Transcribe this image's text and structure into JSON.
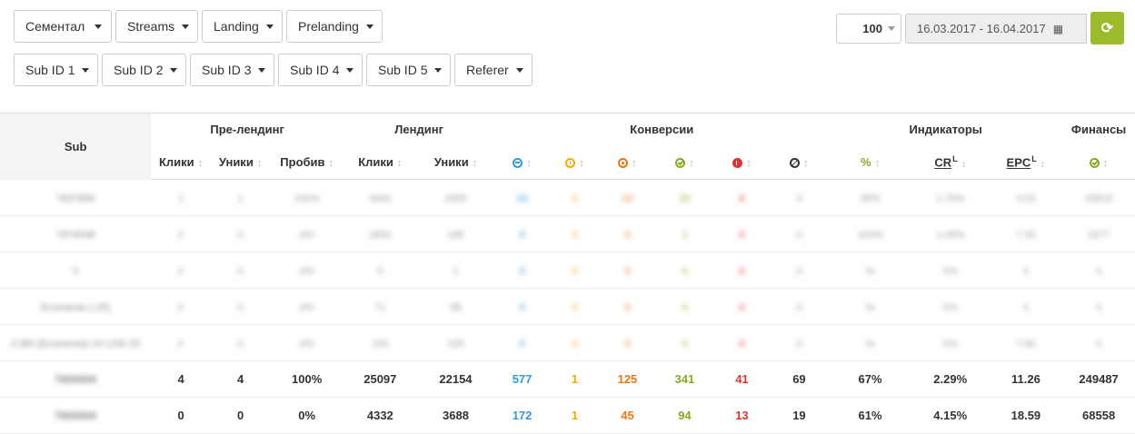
{
  "filters_row1": [
    "Сементал",
    "Streams",
    "Landing",
    "Prelanding"
  ],
  "filters_row2": [
    "Sub ID 1",
    "Sub ID 2",
    "Sub ID 3",
    "Sub ID 4",
    "Sub ID 5",
    "Referer"
  ],
  "limit": {
    "value": "100"
  },
  "date_range": "16.03.2017 - 16.04.2017",
  "colors": {
    "accent": "#9bbb2a",
    "blue": "#3399dd",
    "yellow": "#f0a900",
    "orange": "#ee7711",
    "green": "#88aa22",
    "red": "#dd3333"
  },
  "table": {
    "groups": {
      "sub": "Sub",
      "prelanding": "Пре-лендинг",
      "landing": "Лендинг",
      "conversions": "Конверсии",
      "indicators": "Индикаторы",
      "finance": "Финансы"
    },
    "columns": {
      "pre_clicks": "Клики",
      "pre_uniques": "Уники",
      "pre_probiv": "Пробив",
      "land_clicks": "Клики",
      "land_uniques": "Уники",
      "pct": "%",
      "cr": "CR",
      "epc": "EPC",
      "cr_sup": "L",
      "epc_sup": "L"
    },
    "icons": [
      "arrow-right-circle-icon",
      "clock-icon",
      "dot-circle-icon",
      "check-circle-icon",
      "x-circle-icon",
      "ban-icon",
      "check-circle-icon"
    ],
    "blurred_rows": [
      {
        "sub": "7837890",
        "v": [
          "1",
          "1",
          "100%",
          "3000",
          "2835",
          "43",
          "0",
          "10",
          "20",
          "6",
          "4",
          "48%",
          "1.75%",
          "0.03",
          "33815"
        ]
      },
      {
        "sub": "7874548",
        "v": [
          "0",
          "0",
          "0%",
          "2800",
          "188",
          "0",
          "0",
          "0",
          "1",
          "0",
          "0",
          "100%",
          "1.09%",
          "7.30",
          "1977"
        ]
      },
      {
        "sub": "0",
        "v": [
          "0",
          "0",
          "0%",
          "0",
          "1",
          "0",
          "0",
          "0",
          "0",
          "0",
          "0",
          "%",
          "0%",
          "0",
          "0"
        ]
      },
      {
        "sub": "Ecomerse (-20)",
        "v": [
          "0",
          "0",
          "0%",
          "71",
          "88",
          "0",
          "0",
          "0",
          "0",
          "0",
          "0",
          "%",
          "0%",
          "0",
          "0"
        ]
      },
      {
        "sub": "CJ80 (Ecomerse) 14 LOG 20",
        "v": [
          "0",
          "0",
          "0%",
          "100",
          "105",
          "0",
          "0",
          "0",
          "0",
          "0",
          "0",
          "%",
          "0%",
          "7.80",
          "0"
        ]
      }
    ],
    "rows": [
      {
        "sub": "7800000",
        "v": [
          "4",
          "4",
          "100%",
          "25097",
          "22154",
          "577",
          "1",
          "125",
          "341",
          "41",
          "69",
          "67%",
          "2.29%",
          "11.26",
          "249487"
        ]
      },
      {
        "sub": "7800000",
        "v": [
          "0",
          "0",
          "0%",
          "4332",
          "3688",
          "172",
          "1",
          "45",
          "94",
          "13",
          "19",
          "61%",
          "4.15%",
          "18.59",
          "68558"
        ]
      }
    ]
  }
}
